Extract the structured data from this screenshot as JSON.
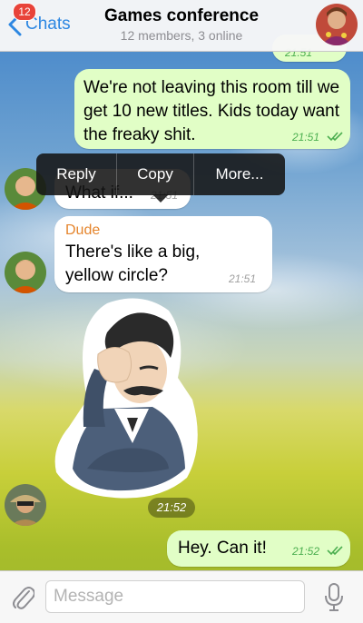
{
  "header": {
    "back_label": "Chats",
    "unread_badge": "12",
    "title": "Games conference",
    "subtitle": "12 members, 3 online"
  },
  "messages": {
    "top_partial_time": "21:51",
    "m1": {
      "text": "We're not leaving this room till we get 10 new titles. Kids today want the freaky shit.",
      "time": "21:51"
    },
    "m2": {
      "text": "What if...",
      "time": "21:51"
    },
    "m3": {
      "sender": "Dude",
      "text": "There's like a big, yellow circle?",
      "time": "21:51"
    },
    "sticker_time": "21:52",
    "m4": {
      "text": "Hey. Can it!",
      "time": "21:52"
    }
  },
  "context_menu": {
    "reply": "Reply",
    "copy": "Copy",
    "more": "More..."
  },
  "composer": {
    "placeholder": "Message",
    "value": ""
  },
  "colors": {
    "accent": "#2d87e2",
    "outgoing_bubble": "#e1fec6",
    "incoming_bubble": "#ffffff",
    "sender_name": "#e5852d",
    "badge": "#e8433a"
  },
  "icons": {
    "back": "chevron-left-icon",
    "attach": "paperclip-icon",
    "mic": "microphone-icon",
    "read": "double-check-icon"
  }
}
